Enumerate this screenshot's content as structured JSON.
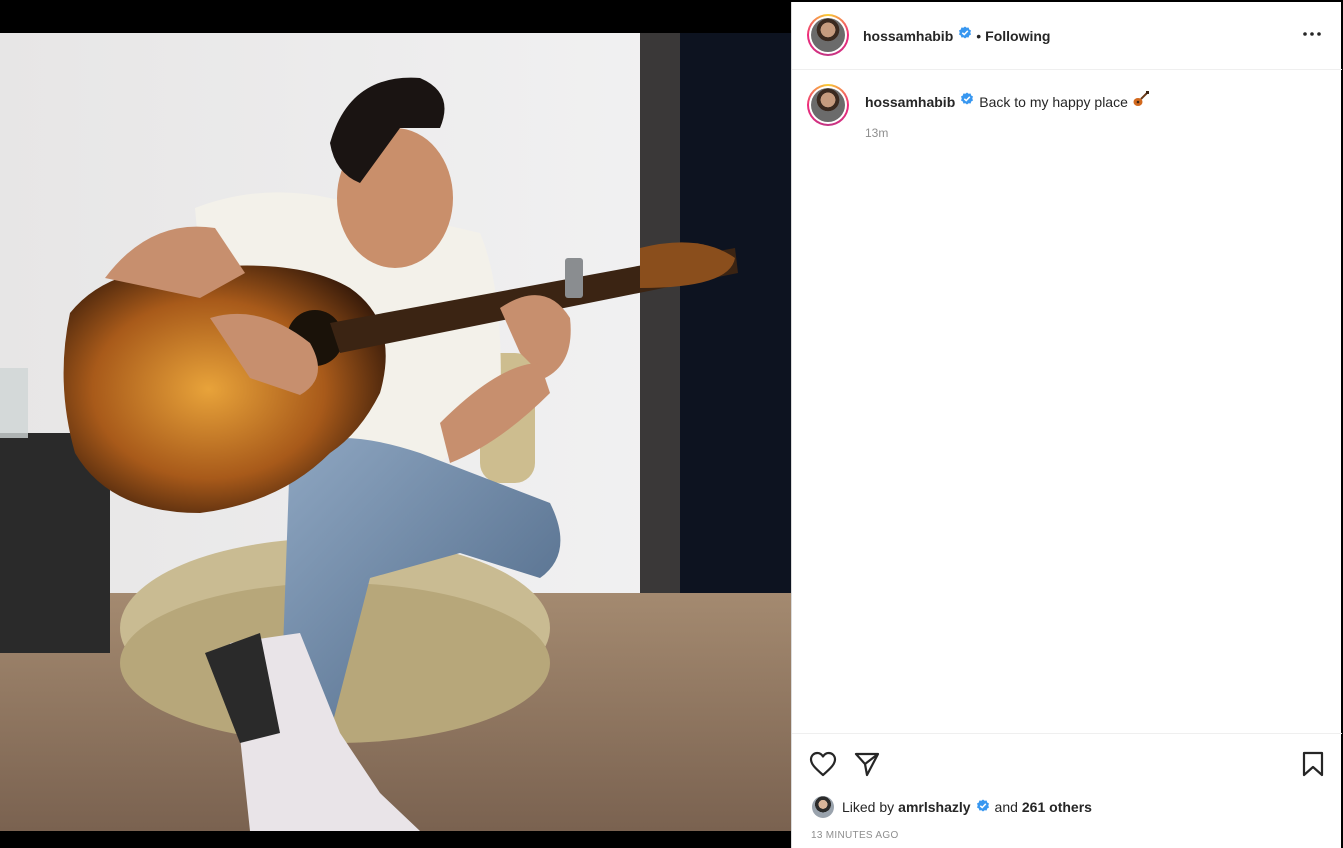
{
  "post": {
    "username": "hossamhabib",
    "follow_status": "Following",
    "separator": "•",
    "caption": "Back to my happy place",
    "caption_emoji": "guitar-emoji",
    "time_ago": "13m",
    "liked_by_prefix": "Liked by",
    "liked_by_user": "amrlshazly",
    "liked_by_and": "and",
    "liked_by_others": "261 others",
    "timestamp": "13 MINUTES AGO"
  },
  "media": {
    "description_icon": "photo-of-man-playing-guitar"
  },
  "icons": {
    "more": "more-options-icon",
    "like": "heart-icon",
    "share": "send-icon",
    "save": "bookmark-icon",
    "verified": "verified-badge-icon"
  },
  "colors": {
    "verified_blue": "#3897f0",
    "text": "#262626",
    "secondary_text": "#8e8e8e",
    "border": "#efefef"
  }
}
